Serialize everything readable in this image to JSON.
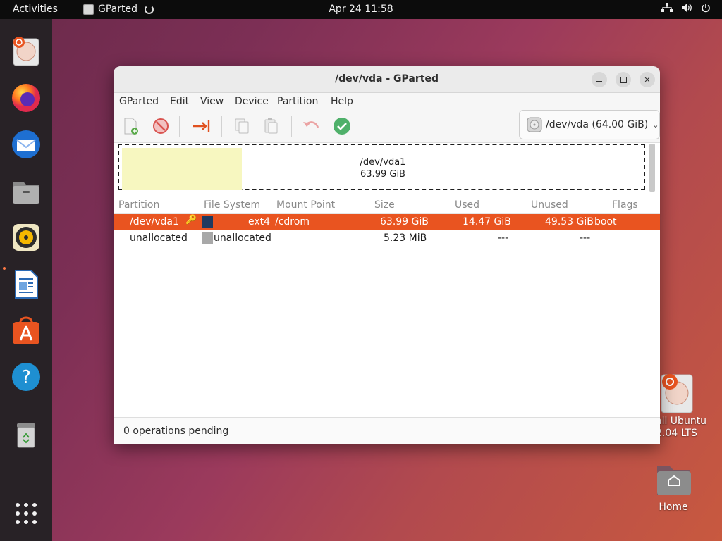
{
  "topbar": {
    "activities": "Activities",
    "app_name": "GParted",
    "clock": "Apr 24  11:58",
    "icons": [
      "network-icon",
      "volume-icon",
      "power-icon"
    ]
  },
  "dock": {
    "items": [
      "install-ubuntu",
      "firefox",
      "thunderbird",
      "files",
      "rhythmbox",
      "libreoffice-writer",
      "app-center",
      "help",
      "trash",
      "show-apps"
    ]
  },
  "window": {
    "title": "/dev/vda - GParted",
    "menu": [
      "GParted",
      "Edit",
      "View",
      "Device",
      "Partition",
      "Help"
    ],
    "device_selector": "/dev/vda (64.00 GiB)",
    "disk_map": {
      "name": "/dev/vda1",
      "size": "63.99 GiB",
      "used_fraction": 0.23
    },
    "columns": [
      "Partition",
      "File System",
      "Mount Point",
      "Size",
      "Used",
      "Unused",
      "Flags"
    ],
    "rows": [
      {
        "partition": "/dev/vda1",
        "fs": "ext4",
        "mount": "/cdrom",
        "size": "63.99 GiB",
        "used": "14.47 GiB",
        "unused": "49.53 GiB",
        "flags": "boot",
        "swatch": "#1f3a60"
      },
      {
        "partition": "unallocated",
        "fs": "unallocated",
        "mount": "",
        "size": "5.23 MiB",
        "used": "---",
        "unused": "---",
        "flags": "",
        "swatch": "#a8a8a8"
      }
    ],
    "status": "0 operations pending"
  },
  "desktop": {
    "install_label_1": "all Ubuntu",
    "install_label_2": "2.04 LTS",
    "home_label": "Home"
  },
  "colors": {
    "accent": "#e95420",
    "topbar": "#0c0c0c",
    "dock": "#282226"
  }
}
